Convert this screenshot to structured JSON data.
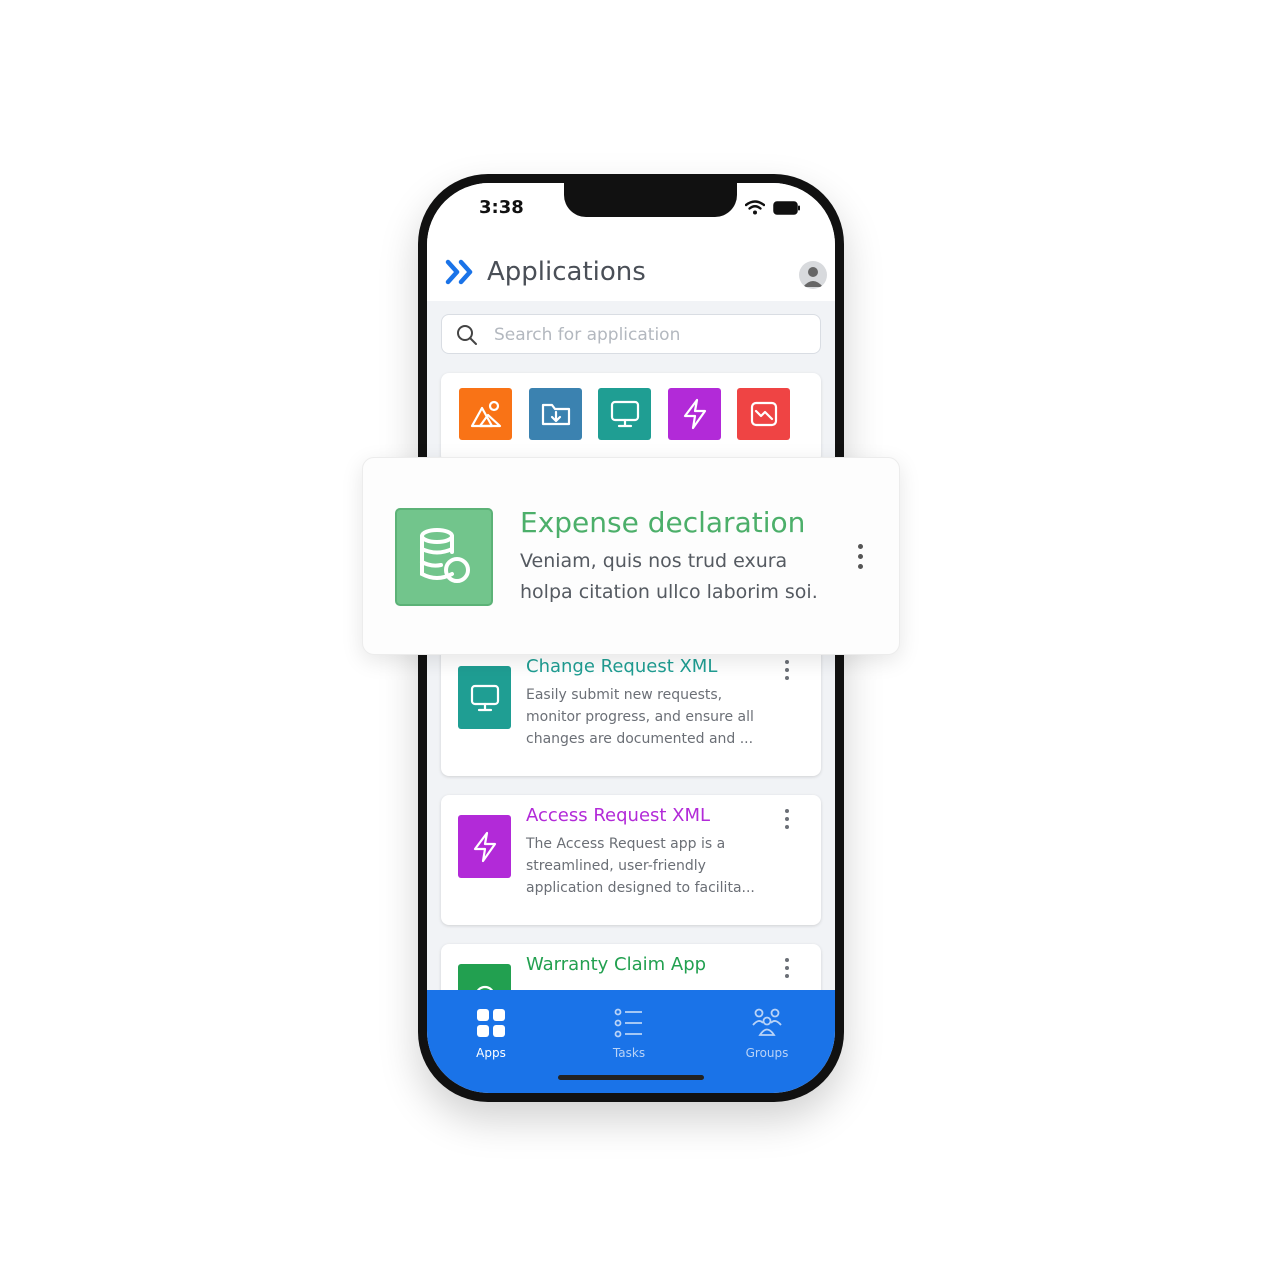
{
  "status_bar": {
    "time": "3:38"
  },
  "header": {
    "title": "Applications"
  },
  "search": {
    "placeholder": "Search for application"
  },
  "quick_apps": [
    {
      "icon": "image-icon",
      "color": "#f97316"
    },
    {
      "icon": "folder-download-icon",
      "color": "#3b82b0"
    },
    {
      "icon": "monitor-icon",
      "color": "#1f9e93"
    },
    {
      "icon": "lightning-icon",
      "color": "#b22ad8"
    },
    {
      "icon": "chart-icon",
      "color": "#ef4444"
    }
  ],
  "featured": {
    "name": "Expense declaration",
    "description": "Veniam, quis nos trud exura holpa citation ullco laborim soi.",
    "icon": "database-coin-icon",
    "color": "#72c58c"
  },
  "apps": [
    {
      "name": "Change Request XML",
      "description": "Easily submit new requests, monitor progress, and ensure all changes are documented and ...",
      "icon": "monitor-icon",
      "color": "#1f9e93"
    },
    {
      "name": "Access Request XML",
      "description": "The Access Request app is a streamlined, user-friendly application designed to facilita...",
      "icon": "lightning-icon",
      "color": "#b22ad8"
    },
    {
      "name": "Warranty Claim App",
      "description": "",
      "icon": "app-icon",
      "color": "#22a050"
    }
  ],
  "bottom_nav": [
    {
      "label": "Apps",
      "icon": "grid-icon",
      "active": true
    },
    {
      "label": "Tasks",
      "icon": "list-icon",
      "active": false
    },
    {
      "label": "Groups",
      "icon": "users-icon",
      "active": false
    }
  ]
}
